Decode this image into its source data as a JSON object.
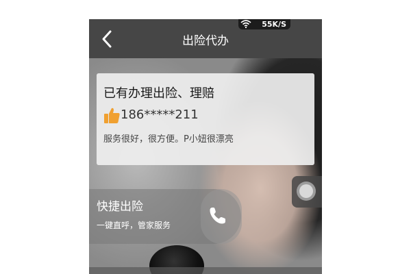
{
  "status_bar": {
    "network_speed": "55K/S",
    "wifi_icon": "wifi-icon"
  },
  "header": {
    "title": "出险代办",
    "back_icon": "chevron-left-icon"
  },
  "review_card": {
    "title": "已有办理出险、理赔",
    "thumb_icon": "thumbs-up-icon",
    "phone": "186*****211",
    "comment": "服务很好，很方便。P小妞很漂亮"
  },
  "quick_claim": {
    "title": "快捷出险",
    "subtitle": "一键直呼，管家服务",
    "call_icon": "phone-icon"
  },
  "colors": {
    "navbar": "#464646",
    "thumb": "#f0a030"
  }
}
